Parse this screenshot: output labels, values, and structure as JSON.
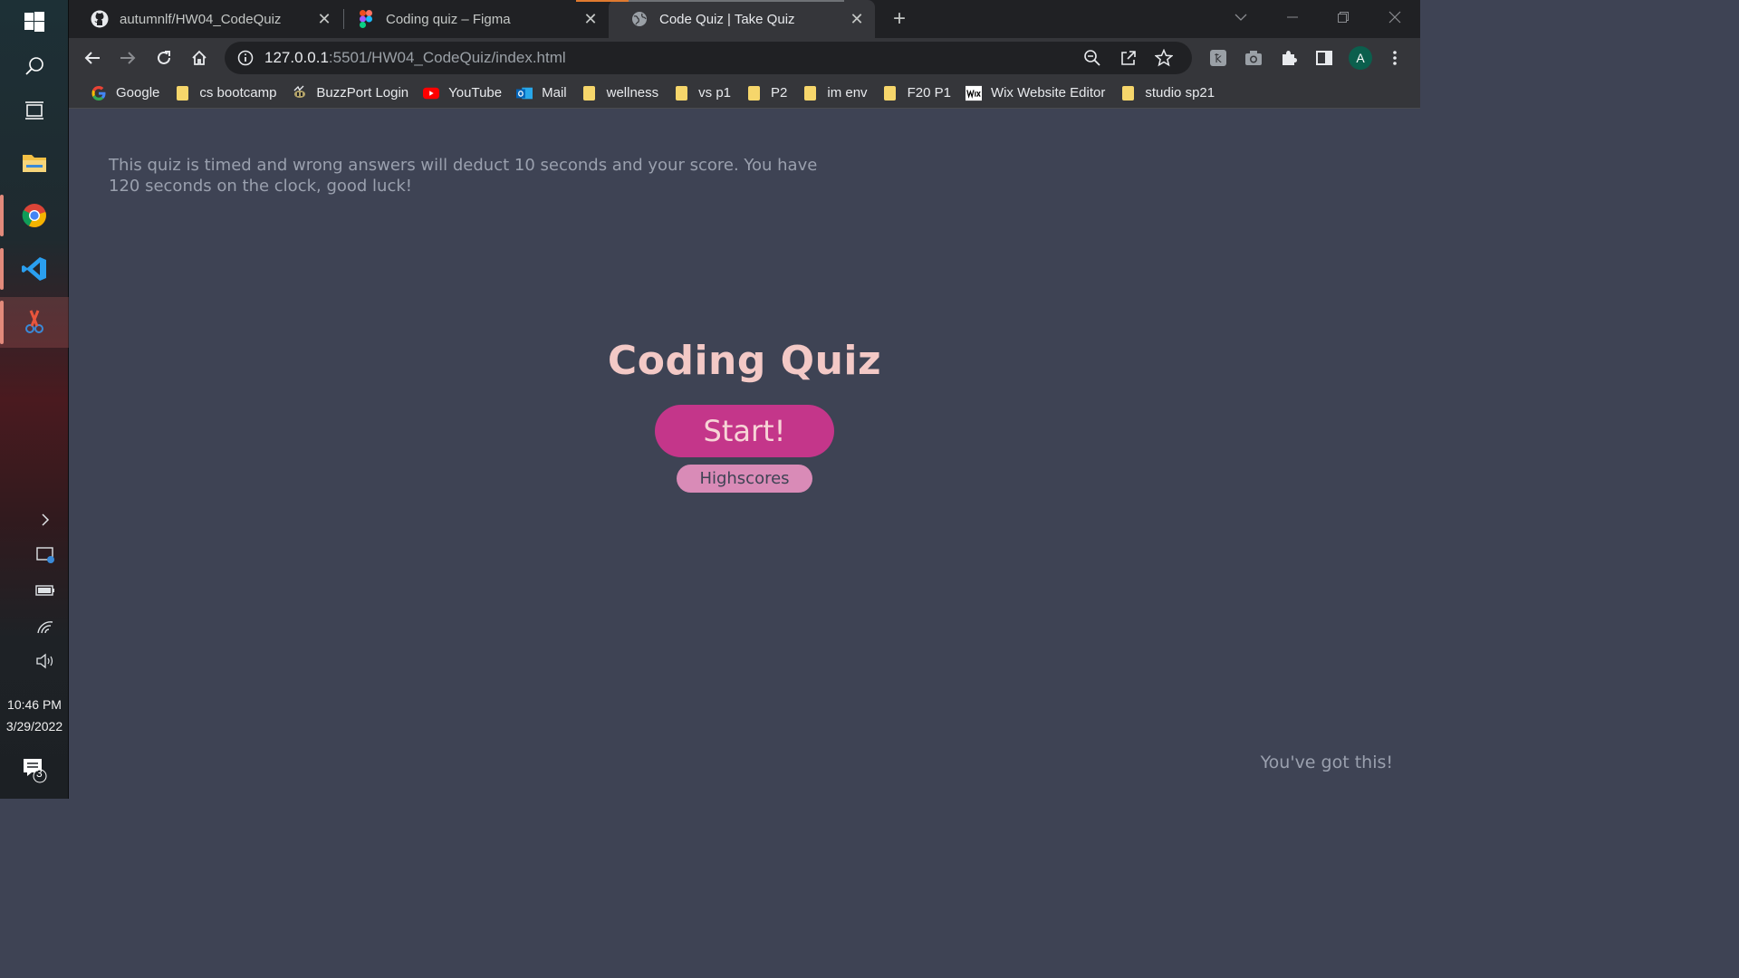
{
  "taskbar": {
    "clock_time": "10:46 PM",
    "clock_date": "3/29/2022",
    "notification_count": "3"
  },
  "tabs": [
    {
      "title": "autumnlf/HW04_CodeQuiz",
      "icon": "github-icon"
    },
    {
      "title": "Coding quiz – Figma",
      "icon": "figma-icon"
    },
    {
      "title": "Code Quiz | Take Quiz",
      "icon": "globe-icon"
    }
  ],
  "address": {
    "host": "127.0.0.1",
    "rest": ":5501/HW04_CodeQuiz/index.html"
  },
  "profile_initial": "A",
  "bookmarks": [
    {
      "label": "Google",
      "icon": "google-icon"
    },
    {
      "label": "cs bootcamp",
      "icon": "folder-icon"
    },
    {
      "label": "BuzzPort Login",
      "icon": "buzzport-icon"
    },
    {
      "label": "YouTube",
      "icon": "youtube-icon"
    },
    {
      "label": "Mail",
      "icon": "outlook-icon"
    },
    {
      "label": "wellness",
      "icon": "folder-icon"
    },
    {
      "label": "vs p1",
      "icon": "folder-icon"
    },
    {
      "label": "P2",
      "icon": "folder-icon"
    },
    {
      "label": "im env",
      "icon": "folder-icon"
    },
    {
      "label": "F20 P1",
      "icon": "folder-icon"
    },
    {
      "label": "Wix Website Editor",
      "icon": "wix-icon"
    },
    {
      "label": "studio sp21",
      "icon": "folder-icon"
    }
  ],
  "page": {
    "instructions": "This quiz is timed and wrong answers will deduct 10 seconds and your score. You have 120 seconds on the clock, good luck!",
    "title": "Coding Quiz",
    "start_label": "Start!",
    "highscores_label": "Highscores",
    "footer": "You've got this!"
  },
  "colors": {
    "page_bg": "#3e4354",
    "title": "#f3c9c6",
    "start_button": "#c4368a",
    "highscores_button": "#d98bb7"
  }
}
